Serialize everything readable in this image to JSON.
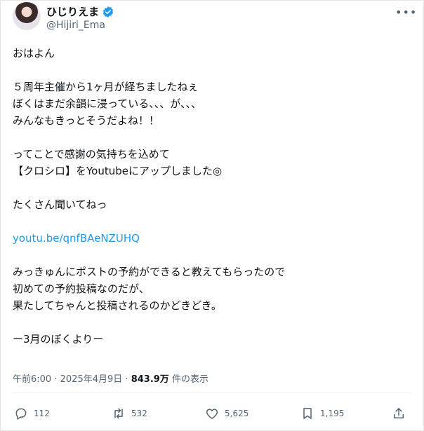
{
  "author": {
    "display_name": "ひじりえま",
    "handle": "@Hijiri_Ema"
  },
  "menu_icon": "more-dots",
  "post": {
    "lines": {
      "l1": "おはよん",
      "l2": "５周年主催から1ヶ月が経ちましたねぇ",
      "l3": "ぼくはまだ余韻に浸っている、、、が、、、",
      "l4": "みんなもきっとそうだよね！！",
      "l5": "ってことで感謝の気持ちを込めて",
      "l6": "【クロシロ】をYoutubeにアップしました◎",
      "l7": "たくさん聞いてねっ",
      "link": "youtu.be/qnfBAeNZUHQ",
      "l8": "みっきゅんにポストの予約ができると教えてもらったので",
      "l9": "初めての予約投稿なのだが、",
      "l10": "果たしてちゃんと投稿されるのかどきどき。",
      "l11": "ー3月のぼくよりー"
    }
  },
  "meta": {
    "time": "午前6:00",
    "sep": "·",
    "date": "2025年4月9日",
    "views_count": "843.9万",
    "views_label": "件の表示"
  },
  "actions": {
    "reply_count": "112",
    "repost_count": "532",
    "like_count": "5,625",
    "bookmark_count": "1,195"
  },
  "colors": {
    "link": "#1d9bf0",
    "verified": "#1d9bf0",
    "secondary_text": "#536471"
  }
}
